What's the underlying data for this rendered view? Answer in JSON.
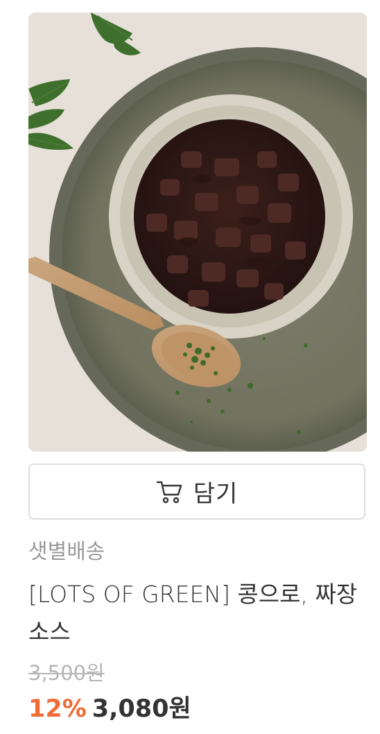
{
  "product": {
    "image_alt": "짜장소스",
    "cart_button_label": "담기",
    "cart_icon": "shopping-cart-icon",
    "delivery_type": "샛별배송",
    "name": "[LOTS OF GREEN] 콩으로, 짜장소스",
    "original_price": "3,500원",
    "discount_rate": "12%",
    "sale_price": "3,080원"
  },
  "colors": {
    "discount": "#f06a35",
    "text_primary": "#333333",
    "text_muted": "#9a9a9a",
    "border": "#dedede"
  }
}
